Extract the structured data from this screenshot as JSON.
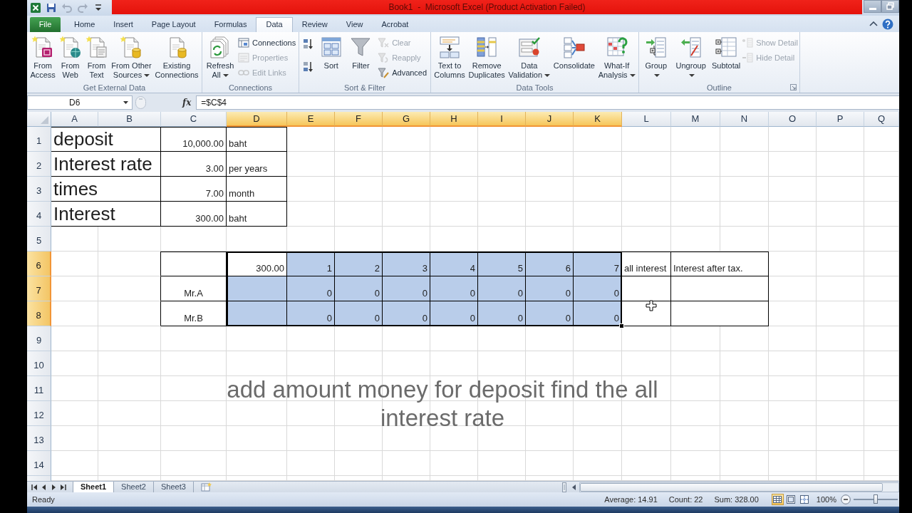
{
  "window": {
    "title": "Book1  -  Microsoft Excel (Product Activation Failed)"
  },
  "ribbon_tabs": [
    {
      "label": "File",
      "kind": "file",
      "selected": false
    },
    {
      "label": "Home",
      "kind": "tab",
      "selected": false
    },
    {
      "label": "Insert",
      "kind": "tab",
      "selected": false
    },
    {
      "label": "Page Layout",
      "kind": "tab",
      "selected": false
    },
    {
      "label": "Formulas",
      "kind": "tab",
      "selected": false
    },
    {
      "label": "Data",
      "kind": "tab",
      "selected": true
    },
    {
      "label": "Review",
      "kind": "tab",
      "selected": false
    },
    {
      "label": "View",
      "kind": "tab",
      "selected": false
    },
    {
      "label": "Acrobat",
      "kind": "tab",
      "selected": false
    }
  ],
  "ribbon_groups": [
    {
      "label": "Get External Data",
      "dialog_launcher": false,
      "buttons": [
        {
          "kind": "large",
          "label": "From\nAccess",
          "dropdown": false,
          "disabled": false
        },
        {
          "kind": "large",
          "label": "From\nWeb",
          "dropdown": false,
          "disabled": false
        },
        {
          "kind": "large",
          "label": "From\nText",
          "dropdown": false,
          "disabled": false
        },
        {
          "kind": "large",
          "label": "From Other\nSources",
          "dropdown": true,
          "disabled": false
        },
        {
          "kind": "large",
          "label": "Existing\nConnections",
          "dropdown": false,
          "disabled": false
        }
      ]
    },
    {
      "label": "Connections",
      "dialog_launcher": false,
      "buttons": [
        {
          "kind": "large",
          "label": "Refresh\nAll",
          "dropdown": true,
          "disabled": false
        },
        {
          "kind": "small",
          "label": "Connections",
          "dropdown": false,
          "disabled": false
        },
        {
          "kind": "small",
          "label": "Properties",
          "dropdown": false,
          "disabled": true
        },
        {
          "kind": "small",
          "label": "Edit Links",
          "dropdown": false,
          "disabled": true
        }
      ]
    },
    {
      "label": "Sort & Filter",
      "dialog_launcher": false,
      "buttons": [
        {
          "kind": "icon",
          "dropdown": false,
          "disabled": false
        },
        {
          "kind": "icon",
          "dropdown": false,
          "disabled": false
        },
        {
          "kind": "large",
          "label": "Sort",
          "dropdown": false,
          "disabled": false
        },
        {
          "kind": "large",
          "label": "Filter",
          "dropdown": false,
          "disabled": false
        },
        {
          "kind": "small",
          "label": "Clear",
          "dropdown": false,
          "disabled": true
        },
        {
          "kind": "small",
          "label": "Reapply",
          "dropdown": false,
          "disabled": true
        },
        {
          "kind": "small",
          "label": "Advanced",
          "dropdown": false,
          "disabled": false
        }
      ]
    },
    {
      "label": "Data Tools",
      "dialog_launcher": false,
      "buttons": [
        {
          "kind": "large",
          "label": "Text to\nColumns",
          "dropdown": false,
          "disabled": false
        },
        {
          "kind": "large",
          "label": "Remove\nDuplicates",
          "dropdown": false,
          "disabled": false
        },
        {
          "kind": "large",
          "label": "Data\nValidation",
          "dropdown": true,
          "disabled": false
        },
        {
          "kind": "large",
          "label": "Consolidate",
          "dropdown": false,
          "disabled": false
        },
        {
          "kind": "large",
          "label": "What-If\nAnalysis",
          "dropdown": true,
          "disabled": false
        }
      ]
    },
    {
      "label": "Outline",
      "dialog_launcher": true,
      "buttons": [
        {
          "kind": "large",
          "label": "Group",
          "dropdown": true,
          "disabled": false
        },
        {
          "kind": "large",
          "label": "Ungroup",
          "dropdown": true,
          "disabled": false
        },
        {
          "kind": "large",
          "label": "Subtotal",
          "dropdown": false,
          "disabled": false
        },
        {
          "kind": "small",
          "label": "Show Detail",
          "dropdown": false,
          "disabled": true
        },
        {
          "kind": "small",
          "label": "Hide Detail",
          "dropdown": false,
          "disabled": true
        }
      ]
    }
  ],
  "formula_bar": {
    "name_box": "D6",
    "function_button": "fx",
    "formula": "=$C$4"
  },
  "columns": [
    {
      "label": "A",
      "selected": false
    },
    {
      "label": "B",
      "selected": false
    },
    {
      "label": "C",
      "selected": false
    },
    {
      "label": "D",
      "selected": true
    },
    {
      "label": "E",
      "selected": true
    },
    {
      "label": "F",
      "selected": true
    },
    {
      "label": "G",
      "selected": true
    },
    {
      "label": "H",
      "selected": true
    },
    {
      "label": "I",
      "selected": true
    },
    {
      "label": "J",
      "selected": true
    },
    {
      "label": "K",
      "selected": true
    },
    {
      "label": "L",
      "selected": false
    },
    {
      "label": "M",
      "selected": false
    },
    {
      "label": "N",
      "selected": false
    },
    {
      "label": "O",
      "selected": false
    },
    {
      "label": "P",
      "selected": false
    },
    {
      "label": "Q",
      "selected": false
    }
  ],
  "rows": [
    {
      "label": "1",
      "selected": false,
      "cells": [
        {
          "text": "deposit",
          "kind": "heading",
          "merged": true,
          "bordered": true,
          "selected": false
        },
        {
          "text": "10,000.00",
          "kind": "number",
          "merged": false,
          "bordered": true,
          "selected": false
        },
        {
          "text": "baht",
          "kind": "text",
          "merged": false,
          "bordered": true,
          "selected": false
        }
      ]
    },
    {
      "label": "2",
      "selected": false,
      "cells": [
        {
          "text": "Interest rate",
          "kind": "heading",
          "merged": true,
          "bordered": true,
          "selected": false
        },
        {
          "text": "3.00",
          "kind": "number",
          "merged": false,
          "bordered": true,
          "selected": false
        },
        {
          "text": "per years",
          "kind": "text",
          "merged": false,
          "bordered": true,
          "selected": false
        }
      ]
    },
    {
      "label": "3",
      "selected": false,
      "cells": [
        {
          "text": "times",
          "kind": "heading",
          "merged": true,
          "bordered": true,
          "selected": false
        },
        {
          "text": "7.00",
          "kind": "number",
          "merged": false,
          "bordered": true,
          "selected": false
        },
        {
          "text": "month",
          "kind": "text",
          "merged": false,
          "bordered": true,
          "selected": false
        }
      ]
    },
    {
      "label": "4",
      "selected": false,
      "cells": [
        {
          "text": "Interest",
          "kind": "heading",
          "merged": true,
          "bordered": true,
          "selected": false
        },
        {
          "text": "300.00",
          "kind": "number",
          "merged": false,
          "bordered": true,
          "selected": false
        },
        {
          "text": "baht",
          "kind": "text",
          "merged": false,
          "bordered": true,
          "selected": false
        }
      ]
    },
    {
      "label": "5",
      "selected": false
    },
    {
      "label": "6",
      "selected": true,
      "cells": [
        {
          "kind": "empty",
          "merged": false,
          "bordered": false,
          "selected": false
        },
        {
          "kind": "empty",
          "merged": false,
          "bordered": false,
          "selected": false
        },
        {
          "kind": "empty",
          "merged": false,
          "bordered": true,
          "selected": false
        },
        {
          "text": "300.00",
          "kind": "number",
          "merged": false,
          "bordered": true,
          "selected": false
        },
        {
          "text": "1",
          "kind": "number",
          "merged": false,
          "bordered": true,
          "selected": true
        },
        {
          "text": "2",
          "kind": "number",
          "merged": false,
          "bordered": true,
          "selected": true
        },
        {
          "text": "3",
          "kind": "number",
          "merged": false,
          "bordered": true,
          "selected": true
        },
        {
          "text": "4",
          "kind": "number",
          "merged": false,
          "bordered": true,
          "selected": true
        },
        {
          "text": "5",
          "kind": "number",
          "merged": false,
          "bordered": true,
          "selected": true
        },
        {
          "text": "6",
          "kind": "number",
          "merged": false,
          "bordered": true,
          "selected": true
        },
        {
          "text": "7",
          "kind": "number",
          "merged": false,
          "bordered": true,
          "selected": true
        },
        {
          "text": "all interest",
          "kind": "text",
          "merged": false,
          "bordered": true,
          "selected": false
        },
        {
          "text": "Interest after tax.",
          "kind": "text",
          "merged": true,
          "bordered": true,
          "selected": false
        }
      ]
    },
    {
      "label": "7",
      "selected": true,
      "cells": [
        {
          "kind": "empty",
          "merged": false,
          "bordered": false,
          "selected": false
        },
        {
          "kind": "empty",
          "merged": false,
          "bordered": false,
          "selected": false
        },
        {
          "text": "Mr.A",
          "kind": "label",
          "merged": false,
          "bordered": true,
          "selected": false
        },
        {
          "kind": "empty",
          "merged": false,
          "bordered": true,
          "selected": true
        },
        {
          "text": "0",
          "kind": "number",
          "merged": false,
          "bordered": true,
          "selected": true
        },
        {
          "text": "0",
          "kind": "number",
          "merged": false,
          "bordered": true,
          "selected": true
        },
        {
          "text": "0",
          "kind": "number",
          "merged": false,
          "bordered": true,
          "selected": true
        },
        {
          "text": "0",
          "kind": "number",
          "merged": false,
          "bordered": true,
          "selected": true
        },
        {
          "text": "0",
          "kind": "number",
          "merged": false,
          "bordered": true,
          "selected": true
        },
        {
          "text": "0",
          "kind": "number",
          "merged": false,
          "bordered": true,
          "selected": true
        },
        {
          "text": "0",
          "kind": "number",
          "merged": false,
          "bordered": true,
          "selected": true
        },
        {
          "kind": "empty",
          "merged": false,
          "bordered": true,
          "selected": false
        },
        {
          "kind": "empty",
          "merged": true,
          "bordered": true,
          "selected": false
        }
      ]
    },
    {
      "label": "8",
      "selected": true,
      "cells": [
        {
          "kind": "empty",
          "merged": false,
          "bordered": false,
          "selected": false
        },
        {
          "kind": "empty",
          "merged": false,
          "bordered": false,
          "selected": false
        },
        {
          "text": "Mr.B",
          "kind": "label",
          "merged": false,
          "bordered": true,
          "selected": false
        },
        {
          "kind": "empty",
          "merged": false,
          "bordered": true,
          "selected": true
        },
        {
          "text": "0",
          "kind": "number",
          "merged": false,
          "bordered": true,
          "selected": true
        },
        {
          "text": "0",
          "kind": "number",
          "merged": false,
          "bordered": true,
          "selected": true
        },
        {
          "text": "0",
          "kind": "number",
          "merged": false,
          "bordered": true,
          "selected": true
        },
        {
          "text": "0",
          "kind": "number",
          "merged": false,
          "bordered": true,
          "selected": true
        },
        {
          "text": "0",
          "kind": "number",
          "merged": false,
          "bordered": true,
          "selected": true
        },
        {
          "text": "0",
          "kind": "number",
          "merged": false,
          "bordered": true,
          "selected": true
        },
        {
          "text": "0",
          "kind": "number",
          "merged": false,
          "bordered": true,
          "selected": true
        },
        {
          "kind": "empty",
          "merged": false,
          "bordered": true,
          "selected": false
        },
        {
          "kind": "empty",
          "merged": true,
          "bordered": true,
          "selected": false
        }
      ]
    },
    {
      "label": "9",
      "selected": false
    },
    {
      "label": "10",
      "selected": false
    },
    {
      "label": "11",
      "selected": false
    },
    {
      "label": "12",
      "selected": false
    },
    {
      "label": "13",
      "selected": false
    },
    {
      "label": "14",
      "selected": false
    }
  ],
  "caption": "add amount money for deposit find the all interest rate",
  "sheet_tabs": [
    {
      "label": "Sheet1",
      "selected": true
    },
    {
      "label": "Sheet2",
      "selected": false
    },
    {
      "label": "Sheet3",
      "selected": false
    }
  ],
  "status_bar": {
    "mode": "Ready",
    "stats": [
      "Average: 14.91",
      "Count: 22",
      "Sum: 328.00"
    ],
    "views": [
      {
        "selected": true
      },
      {
        "selected": false
      },
      {
        "selected": false
      }
    ],
    "zoom": "100%",
    "zoom_slider": {
      "level": 0.5
    }
  }
}
